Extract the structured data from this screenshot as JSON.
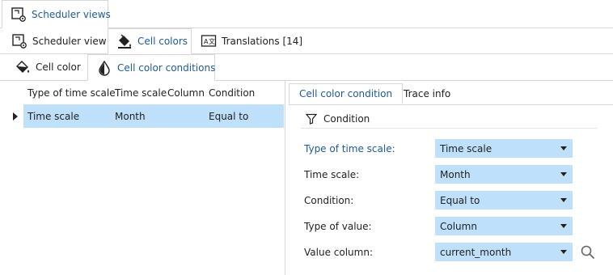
{
  "top_tabs": [
    {
      "label": "Scheduler views",
      "icon": "scheduler-view-icon"
    }
  ],
  "view_tabs": [
    {
      "label": "Scheduler view",
      "icon": "scheduler-view-icon"
    },
    {
      "label": "Cell colors",
      "icon": "paint-bucket-icon"
    },
    {
      "label": "Translations [14]",
      "icon": "translate-icon"
    }
  ],
  "color_tabs": [
    {
      "label": "Cell color",
      "icon": "paint-bucket-icon"
    },
    {
      "label": "Cell color conditions",
      "icon": "drop-icon"
    }
  ],
  "grid": {
    "columns": [
      "Type of time scale",
      "Time scale",
      "Column",
      "Condition"
    ],
    "rows": [
      {
        "type_of_time_scale": "Time scale",
        "time_scale": "Month",
        "column": "",
        "condition": "Equal to"
      }
    ]
  },
  "detail_tabs": [
    "Cell color condition",
    "Trace info"
  ],
  "section_title": "Condition",
  "fields": [
    {
      "label": "Type of time scale:",
      "value": "Time scale"
    },
    {
      "label": "Time scale:",
      "value": "Month"
    },
    {
      "label": "Condition:",
      "value": "Equal to"
    },
    {
      "label": "Type of value:",
      "value": "Column"
    },
    {
      "label": "Value column:",
      "value": "current_month"
    }
  ],
  "colors": {
    "accent": "#1f5a99",
    "selection": "#bfe0fa",
    "border": "#d7d7d7"
  }
}
